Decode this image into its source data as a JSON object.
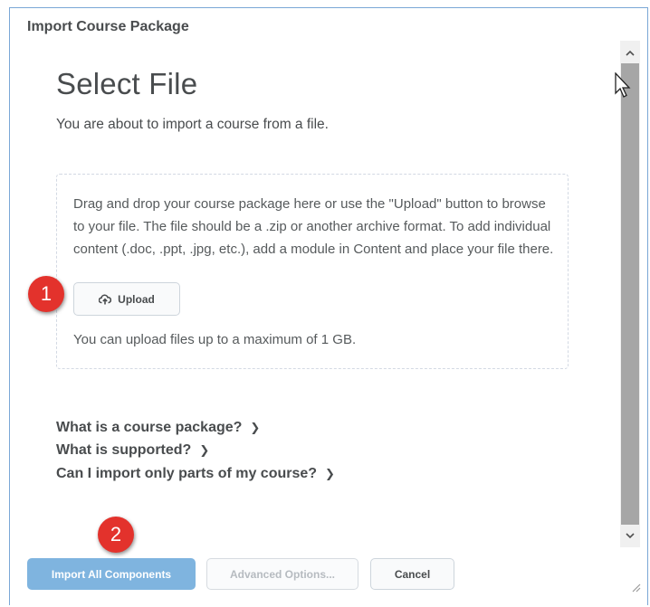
{
  "dialog": {
    "title": "Import Course Package"
  },
  "main": {
    "heading": "Select File",
    "intro": "You are about to import a course from a file."
  },
  "dropzone": {
    "instructions": "Drag and drop your course package here or use the \"Upload\" button to browse to your file. The file should be a .zip or another archive format. To add individual content (.doc, .ppt, .jpg, etc.), add a module in Content and place your file there.",
    "upload_label": "Upload",
    "upload_icon": "cloud-upload-icon",
    "limit": "You can upload files up to a maximum of 1 GB."
  },
  "help_links": [
    {
      "label": "What is a course package?"
    },
    {
      "label": "What is supported?"
    },
    {
      "label": "Can I import only parts of my course?"
    }
  ],
  "footer": {
    "import_all": "Import All Components",
    "advanced": "Advanced Options...",
    "cancel": "Cancel"
  },
  "badges": [
    "1",
    "2"
  ],
  "colors": {
    "primary": "#7fb4df",
    "badge": "#e3322c",
    "text": "#494c4e",
    "frame_border": "#7aa7d6"
  }
}
